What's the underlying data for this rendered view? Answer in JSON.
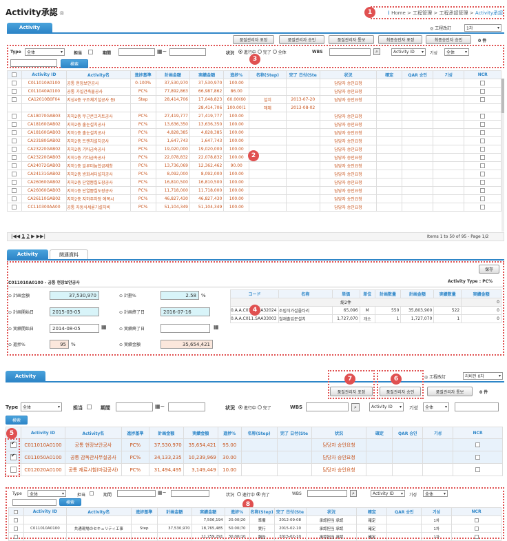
{
  "header": {
    "title": "Activity承認",
    "title_sup": "®",
    "breadcrumb": [
      "Home",
      "工程管理",
      "工程承認管理",
      "Activity承認"
    ]
  },
  "badges": [
    "1",
    "2",
    "3",
    "4",
    "5",
    "6",
    "7",
    "8"
  ],
  "top": {
    "tab": "Activity",
    "sched_label": "工程改訂",
    "sched_value": "1차",
    "buttons": [
      "품질관리자 표정",
      "품질관리자 승인",
      "품질관리자 통보",
      "최종승인자 표정",
      "최종승인자 승인"
    ],
    "count": "0 件",
    "filter": {
      "type_label": "Type",
      "type_value": "全体",
      "owner_label": "担当",
      "period_label": "期間",
      "status_label": "状況",
      "status_opts": [
        "進行中",
        "完了",
        "全体"
      ],
      "wbs_label": "WBS",
      "sort_value": "Activity ID",
      "base_label": "기성",
      "base_value": "全体",
      "search_btn": "検索"
    },
    "columns": [
      "",
      "Activity ID",
      "Activity名",
      "進捗基準",
      "計画金額",
      "実績金額",
      "進捗%",
      "名称(Step)",
      "完了 日付(Ste",
      "状況",
      "確定",
      "QAR 승인",
      "기성",
      "NCR"
    ],
    "rows": [
      [
        "C011010A0100",
        "공통 현장보안공사",
        "0-100%",
        "37,530,970",
        "37,530,970",
        "100.00",
        "",
        "",
        "담당자 승인요청"
      ],
      [
        "C011040A0100",
        "공통 가설건축물공사",
        "PC%",
        "77,892,863",
        "66,987,862",
        "86.00",
        "",
        "",
        "담당자 승인요청"
      ],
      [
        "CA12010B0F04",
        "지상4층 구조체기설공사 동I",
        "Step",
        "28,414,706",
        "17,048,823",
        "60.00(60",
        "설치",
        "2013-07-20",
        "담당자 승인요청"
      ],
      [
        "",
        "",
        "",
        "",
        "28,414,706",
        "100.00(1",
        "해체",
        "2013-08-02",
        ""
      ],
      [
        "CA18070GAB03",
        "지하2층 무근콘크리트공사",
        "PC%",
        "27,419,777",
        "27,419,777",
        "100.00",
        "",
        "",
        "담당자 승인요청"
      ],
      [
        "CA18160GAB02",
        "지하2층 출눈설치공사",
        "PC%",
        "13,636,350",
        "13,636,350",
        "100.00",
        "",
        "",
        "담당자 승인요청"
      ],
      [
        "CA18160GAB03",
        "지하1층 출눈설치공사",
        "PC%",
        "4,828,385",
        "4,828,385",
        "100.00",
        "",
        "",
        "담당자 승인요청"
      ],
      [
        "CA23180GAB02",
        "지하2층 트랜치설치공사",
        "PC%",
        "1,647,743",
        "1,647,743",
        "100.00",
        "",
        "",
        "담당자 승인요청"
      ],
      [
        "CA23220GAB02",
        "지하2층 기타금속공사",
        "PC%",
        "19,020,000",
        "19,020,000",
        "100.00",
        "",
        "",
        "담당자 승인요청"
      ],
      [
        "CA23220GAB03",
        "지하1층 기타금속공사",
        "PC%",
        "22,078,832",
        "22,078,832",
        "100.00",
        "",
        "",
        "담당자 승인요청"
      ],
      [
        "CA24072GAB03",
        "지하1층 알루미늄합금제창",
        "PC%",
        "13,736,069",
        "12,362,462",
        "90.00",
        "",
        "",
        "담당자 승인요청"
      ],
      [
        "CA24131GAB02",
        "지하2층 방화셔터설치공사",
        "PC%",
        "8,092,000",
        "8,092,000",
        "100.00",
        "",
        "",
        "담당자 승인요청"
      ],
      [
        "CA26060GAB02",
        "지하2층 단열뿜칠도장공사",
        "PC%",
        "16,810,500",
        "16,810,500",
        "100.00",
        "",
        "",
        "담당자 승인요청"
      ],
      [
        "CA26060GAB03",
        "지하1층 단열뿜칠도장공사",
        "PC%",
        "11,718,000",
        "11,718,000",
        "100.00",
        "",
        "",
        "담당자 승인요청"
      ],
      [
        "CA26110GAB02",
        "지하2층 지하주차장 에폭시",
        "PC%",
        "46,827,430",
        "46,827,430",
        "100.00",
        "",
        "",
        "담당자 승인요청"
      ],
      [
        "CC110300AA00",
        "공통 자동식세륜기설치비",
        "PC%",
        "51,104,349",
        "51,104,349",
        "100.00",
        "",
        "",
        "담당자 승인요청"
      ]
    ],
    "pager": {
      "pages": [
        "1",
        "2"
      ],
      "info": "Items 1 to 50 of 95 - Page 1/2"
    }
  },
  "detail": {
    "tabs": [
      "Activity",
      "関連資料"
    ],
    "save": "保存",
    "heading": "C011010A0100 - 공통 현장보안공사",
    "acttype": "Activity Type : PC%",
    "fields": {
      "plan_amt_label": "計画金額",
      "plan_amt": "37,530,970",
      "plan_pct_label": "計劃%",
      "plan_pct": "2.58",
      "pct": "%",
      "plan_start_label": "計画開始日",
      "plan_start": "2015-03-05",
      "plan_end_label": "計画終了日",
      "plan_end": "2016-07-16",
      "act_start_label": "実績開始日",
      "act_start": "2014-08-05",
      "act_end_label": "実績終了日",
      "act_end": "",
      "prog_label": "進捗%",
      "prog": "95",
      "act_amt_label": "実績金額",
      "act_amt": "35,654,421"
    },
    "res_cols": [
      "コード",
      "名称",
      "単価",
      "単位",
      "計画数量",
      "計画金額",
      "実績数量",
      "実績金額"
    ],
    "res_total": "総2件",
    "res_total_val": "0",
    "res_rows": [
      [
        "0.A.A.C011.SAA32024",
        "조립식가설울타리",
        "65,096",
        "M",
        "550",
        "35,803,900",
        "522",
        "0"
      ],
      [
        "0.A.A.C011.SAA33003",
        "철재출입문설치",
        "1,727,070",
        "개소",
        "1",
        "1,727,070",
        "1",
        "0"
      ]
    ]
  },
  "bottom": {
    "tab": "Activity",
    "sched_label": "工程改訂",
    "sched_value": "리비전 0차",
    "buttons": [
      "품질관리자 표정",
      "품질관리자 승인",
      "품질관리자 통보"
    ],
    "count": "0 件",
    "filter": {
      "type_label": "Type",
      "type_value": "全体",
      "owner_label": "担当",
      "period_label": "期間",
      "status_label": "状況",
      "status_opts": [
        "進行中",
        "完了"
      ],
      "wbs_label": "WBS",
      "sort_value": "Activity ID",
      "base_label": "기성",
      "base_value": "全体",
      "search_btn": "検索"
    },
    "columns": [
      "",
      "Activity ID",
      "Activity名",
      "進捗基準",
      "計画金額",
      "実績金額",
      "進捗%",
      "名称(Step)",
      "完了 日付(Ste",
      "状況",
      "確定",
      "QAR 승인",
      "기성",
      "NCR"
    ],
    "rows": [
      [
        "C011010A0100",
        "공통 현장보안공사",
        "PC%",
        "37,530,970",
        "35,654,421",
        "95.00",
        "",
        "",
        "담당자 승인요청"
      ],
      [
        "C011050A0100",
        "공통 감독관사무실공사",
        "PC%",
        "34,133,235",
        "10,239,969",
        "30.00",
        "",
        "",
        "담당자 승인요청"
      ],
      [
        "C012020A0100",
        "공통 재료시험(마감공사)",
        "PC%",
        "31,494,495",
        "3,149,449",
        "10.00",
        "",
        "",
        "담당자 승인요청"
      ]
    ]
  },
  "mini": {
    "filter": {
      "type_label": "Type",
      "type_value": "全体",
      "owner_label": "担当",
      "period_label": "期間",
      "status_label": "状況",
      "status_opts": [
        "進行中",
        "完了"
      ],
      "wbs_label": "WBS",
      "sort_value": "Activity ID",
      "base_label": "기성",
      "base_value": "全体",
      "search_btn": "検索"
    },
    "columns": [
      "",
      "Activity ID",
      "Activity名",
      "進捗基準",
      "計画金額",
      "実績金額",
      "進捗%",
      "名称(Step)",
      "完了 日付(Ste",
      "状況",
      "確定",
      "QAR 승인",
      "기성",
      "NCR"
    ],
    "rows": [
      [
        "",
        "",
        "",
        "",
        "7,506,194",
        "20.00(20",
        "準備",
        "2012-09-08",
        "承認担当 承認",
        "確定",
        "",
        "1차"
      ],
      [
        "C011010A0100",
        "共通現場のセキュリティ工事",
        "Step",
        "37,530,970",
        "18,765,485",
        "50.00(70",
        "実行",
        "2015-02-10",
        "承認担当 承認",
        "確定",
        "",
        "1차"
      ],
      [
        "",
        "",
        "",
        "",
        "11,259,291",
        "30.00(10",
        "報告",
        "2015-02-10",
        "承認担当 承認",
        "確定",
        "",
        "1차"
      ]
    ]
  }
}
